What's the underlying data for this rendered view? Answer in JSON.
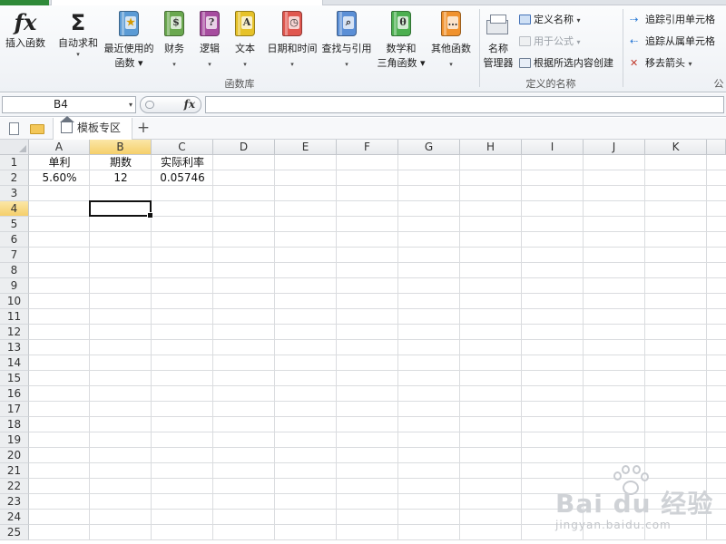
{
  "ribbon": {
    "buttons": [
      {
        "label1": "插入函数",
        "label2": "",
        "icon": "fx-icon"
      },
      {
        "label1": "自动求和",
        "label2": "▾",
        "icon": "sigma-icon"
      },
      {
        "label1": "最近使用的",
        "label2": "函数 ▾",
        "icon": "recent-book-icon"
      },
      {
        "label1": "财务",
        "label2": "▾",
        "icon": "finance-book-icon"
      },
      {
        "label1": "逻辑",
        "label2": "▾",
        "icon": "logic-book-icon"
      },
      {
        "label1": "文本",
        "label2": "▾",
        "icon": "text-book-icon"
      },
      {
        "label1": "日期和时间",
        "label2": "▾",
        "icon": "datetime-book-icon"
      },
      {
        "label1": "查找与引用",
        "label2": "▾",
        "icon": "lookup-book-icon"
      },
      {
        "label1": "数学和",
        "label2": "三角函数 ▾",
        "icon": "math-book-icon"
      },
      {
        "label1": "其他函数",
        "label2": "▾",
        "icon": "more-book-icon"
      },
      {
        "label1": "名称",
        "label2": "管理器",
        "icon": "name-manager-icon"
      }
    ],
    "group_library": "函数库",
    "group_names": "定义的名称",
    "group_audit_partial": "公",
    "names_items": {
      "define": "定义名称",
      "use_in_formula": "用于公式",
      "create_from_selection": "根据所选内容创建"
    },
    "audit_items": {
      "trace_precedents": "追踪引用单元格",
      "trace_dependents": "追踪从属单元格",
      "remove_arrows": "移去箭头"
    },
    "icon_glyphs": {
      "fx": "fx",
      "sigma": "Σ",
      "recent": "★",
      "finance": "$",
      "logic": "?",
      "text": "A",
      "datetime": "◷",
      "lookup": "⌕",
      "math": "θ",
      "more": "…",
      "dropdown": "▾"
    },
    "book_colors": {
      "recent": "#5b9bd5",
      "finance": "#6aa84f",
      "logic": "#a64d9f",
      "text": "#e6c229",
      "datetime": "#e0574f",
      "lookup": "#5b8fd6",
      "math": "#4caf50",
      "more": "#f0922e"
    }
  },
  "formula_bar": {
    "name_box": "B4",
    "fx_label": "fx",
    "formula": ""
  },
  "tabs": {
    "doc_tab": "模板专区",
    "new_tab": "+"
  },
  "sheet": {
    "columns": [
      "A",
      "B",
      "C",
      "D",
      "E",
      "F",
      "G",
      "H",
      "I",
      "J",
      "K"
    ],
    "rows": [
      "1",
      "2",
      "3",
      "4",
      "5",
      "6",
      "7",
      "8",
      "9",
      "10",
      "11",
      "12",
      "13",
      "14",
      "15",
      "16",
      "17",
      "18",
      "19",
      "20",
      "21",
      "22",
      "23",
      "24",
      "25"
    ],
    "active_column": "B",
    "active_row": "4",
    "cells": {
      "A1": "单利",
      "B1": "期数",
      "C1": "实际利率",
      "A2": "5.60%",
      "B2": "12",
      "C2": "0.05746"
    }
  },
  "watermark": {
    "brand": "Bai du 经验",
    "url": "jingyan.baidu.com"
  }
}
